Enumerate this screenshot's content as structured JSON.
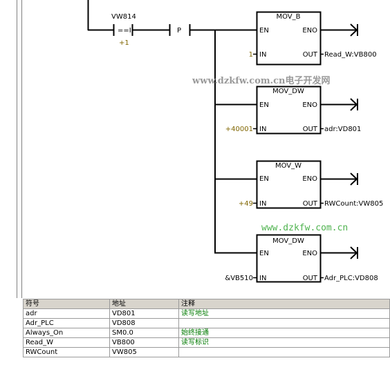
{
  "network": {
    "contact": {
      "operand": "VW814",
      "op": "==I",
      "value": "+1"
    },
    "p_label": "P",
    "blocks": [
      {
        "name": "MOV_B",
        "en": "EN",
        "eno": "ENO",
        "in_label": "IN",
        "out_label": "OUT",
        "in_value": "1",
        "out_value": "Read_W:VB800"
      },
      {
        "name": "MOV_DW",
        "en": "EN",
        "eno": "ENO",
        "in_label": "IN",
        "out_label": "OUT",
        "in_value": "+40001",
        "out_value": "adr:VD801"
      },
      {
        "name": "MOV_W",
        "en": "EN",
        "eno": "ENO",
        "in_label": "IN",
        "out_label": "OUT",
        "in_value": "+49",
        "out_value": "RWCount:VW805"
      },
      {
        "name": "MOV_DW",
        "en": "EN",
        "eno": "ENO",
        "in_label": "IN",
        "out_label": "OUT",
        "in_value": "&VB510",
        "out_value": "Adr_PLC:VD808"
      }
    ]
  },
  "watermarks": [
    "www.dzkfw.com.cn电子开发网",
    "www.dzkfw.com.cn"
  ],
  "symbol_table": {
    "headers": [
      "符号",
      "地址",
      "注释"
    ],
    "rows": [
      {
        "symbol": "adr",
        "address": "VD801",
        "comment": "读写地址"
      },
      {
        "symbol": "Adr_PLC",
        "address": "VD808",
        "comment": ""
      },
      {
        "symbol": "Always_On",
        "address": "SM0.0",
        "comment": "始终接通"
      },
      {
        "symbol": "Read_W",
        "address": "VB800",
        "comment": "读写标识"
      },
      {
        "symbol": "RWCount",
        "address": "VW805",
        "comment": ""
      }
    ]
  },
  "colors": {
    "comment_text": "#007a00",
    "constant_text": "#806600",
    "header_bg": "#d8d4cc"
  }
}
